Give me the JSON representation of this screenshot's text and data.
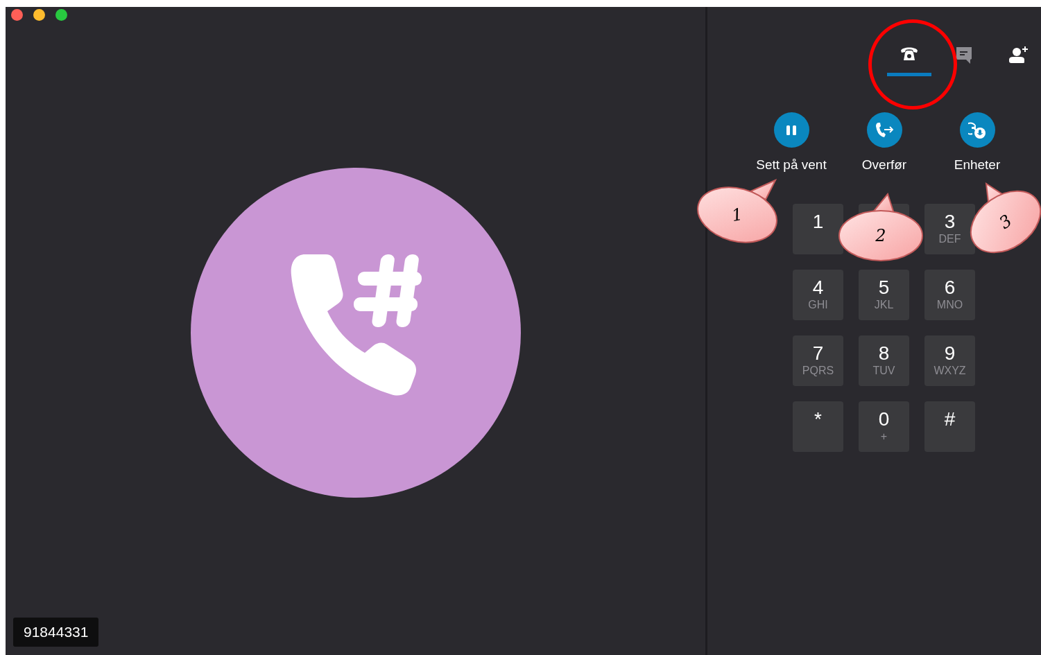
{
  "window": {
    "traffic_lights": [
      {
        "color": "#fe5f57"
      },
      {
        "color": "#febc2e"
      },
      {
        "color": "#28c840"
      }
    ]
  },
  "call_view": {
    "caller_number": "91844331"
  },
  "tabs": [
    {
      "kind": "call",
      "selected": true,
      "disabled": false
    },
    {
      "kind": "chat",
      "selected": false,
      "disabled": true
    },
    {
      "kind": "add-person",
      "selected": false,
      "disabled": false
    }
  ],
  "actions": [
    {
      "kind": "hold",
      "label": "Sett på vent"
    },
    {
      "kind": "transfer",
      "label": "Overfør"
    },
    {
      "kind": "devices",
      "label": "Enheter"
    }
  ],
  "keypad": [
    {
      "kind": "digit",
      "digit": "1"
    },
    {
      "kind": "blank"
    },
    {
      "kind": "digit",
      "digit": "3",
      "letters": "DEF"
    },
    {
      "kind": "digit",
      "digit": "4",
      "letters": "GHI"
    },
    {
      "kind": "digit",
      "digit": "5",
      "letters": "JKL"
    },
    {
      "kind": "digit",
      "digit": "6",
      "letters": "MNO"
    },
    {
      "kind": "digit",
      "digit": "7",
      "letters": "PQRS"
    },
    {
      "kind": "digit",
      "digit": "8",
      "letters": "TUV"
    },
    {
      "kind": "digit",
      "digit": "9",
      "letters": "WXYZ"
    },
    {
      "kind": "digit",
      "digit": "*"
    },
    {
      "kind": "digit",
      "digit": "0",
      "letters": "+"
    },
    {
      "kind": "digit",
      "digit": "#"
    }
  ],
  "annotations": {
    "circle_on_selected_tab": true,
    "callouts": [
      {
        "text": "1"
      },
      {
        "text": "2"
      },
      {
        "text": "3"
      }
    ]
  }
}
